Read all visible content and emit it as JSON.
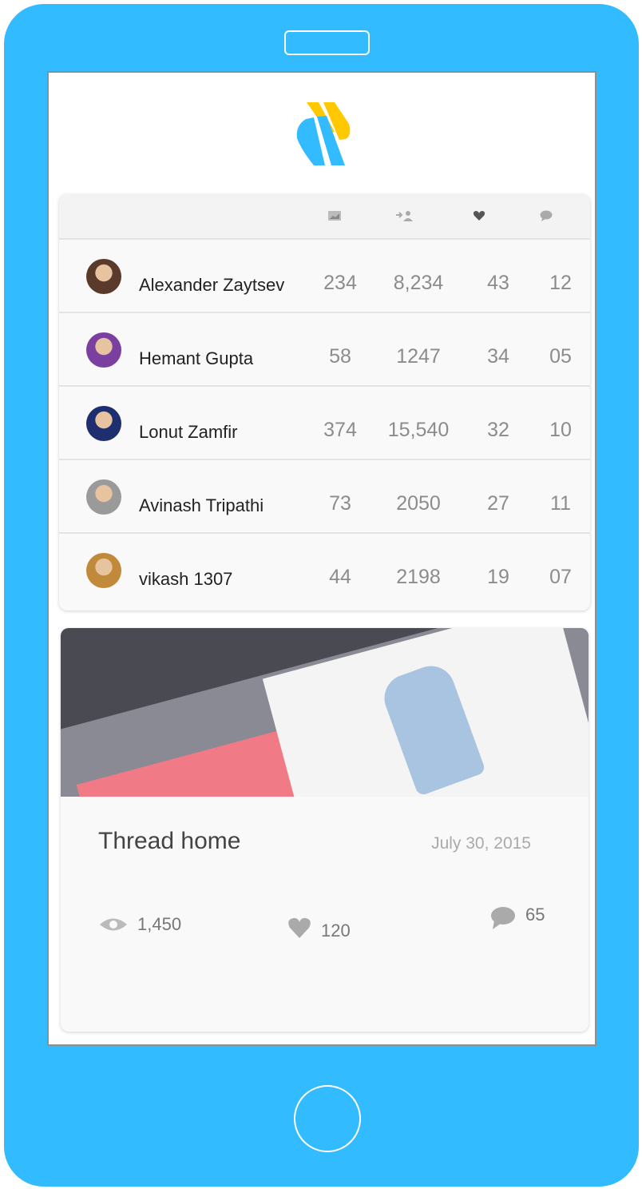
{
  "header": {
    "columns": [
      {
        "icon": "image-icon"
      },
      {
        "icon": "followers-icon"
      },
      {
        "icon": "heart-icon"
      },
      {
        "icon": "comment-icon"
      }
    ]
  },
  "users": [
    {
      "name": "Alexander Zaytsev",
      "shots": "234",
      "followers": "8,234",
      "likes": "43",
      "comments": "12",
      "avatar_color": "#5a3a2a"
    },
    {
      "name": "Hemant Gupta",
      "shots": "58",
      "followers": "1247",
      "likes": "34",
      "comments": "05",
      "avatar_color": "#7b3fa0"
    },
    {
      "name": "Lonut Zamfir",
      "shots": "374",
      "followers": "15,540",
      "likes": "32",
      "comments": "10",
      "avatar_color": "#1d2f6e"
    },
    {
      "name": "Avinash Tripathi",
      "shots": "73",
      "followers": "2050",
      "likes": "27",
      "comments": "11",
      "avatar_color": "#9a9a9a"
    },
    {
      "name": "vikash 1307",
      "shots": "44",
      "followers": "2198",
      "likes": "19",
      "comments": "07",
      "avatar_color": "#c08a3a"
    }
  ],
  "post": {
    "title": "Thread home",
    "date": "July 30, 2015",
    "views": "1,450",
    "likes": "120",
    "comments": "65"
  },
  "colors": {
    "phone": "#33bbff",
    "logo_blue": "#33bbff",
    "logo_yellow": "#ffc800"
  }
}
